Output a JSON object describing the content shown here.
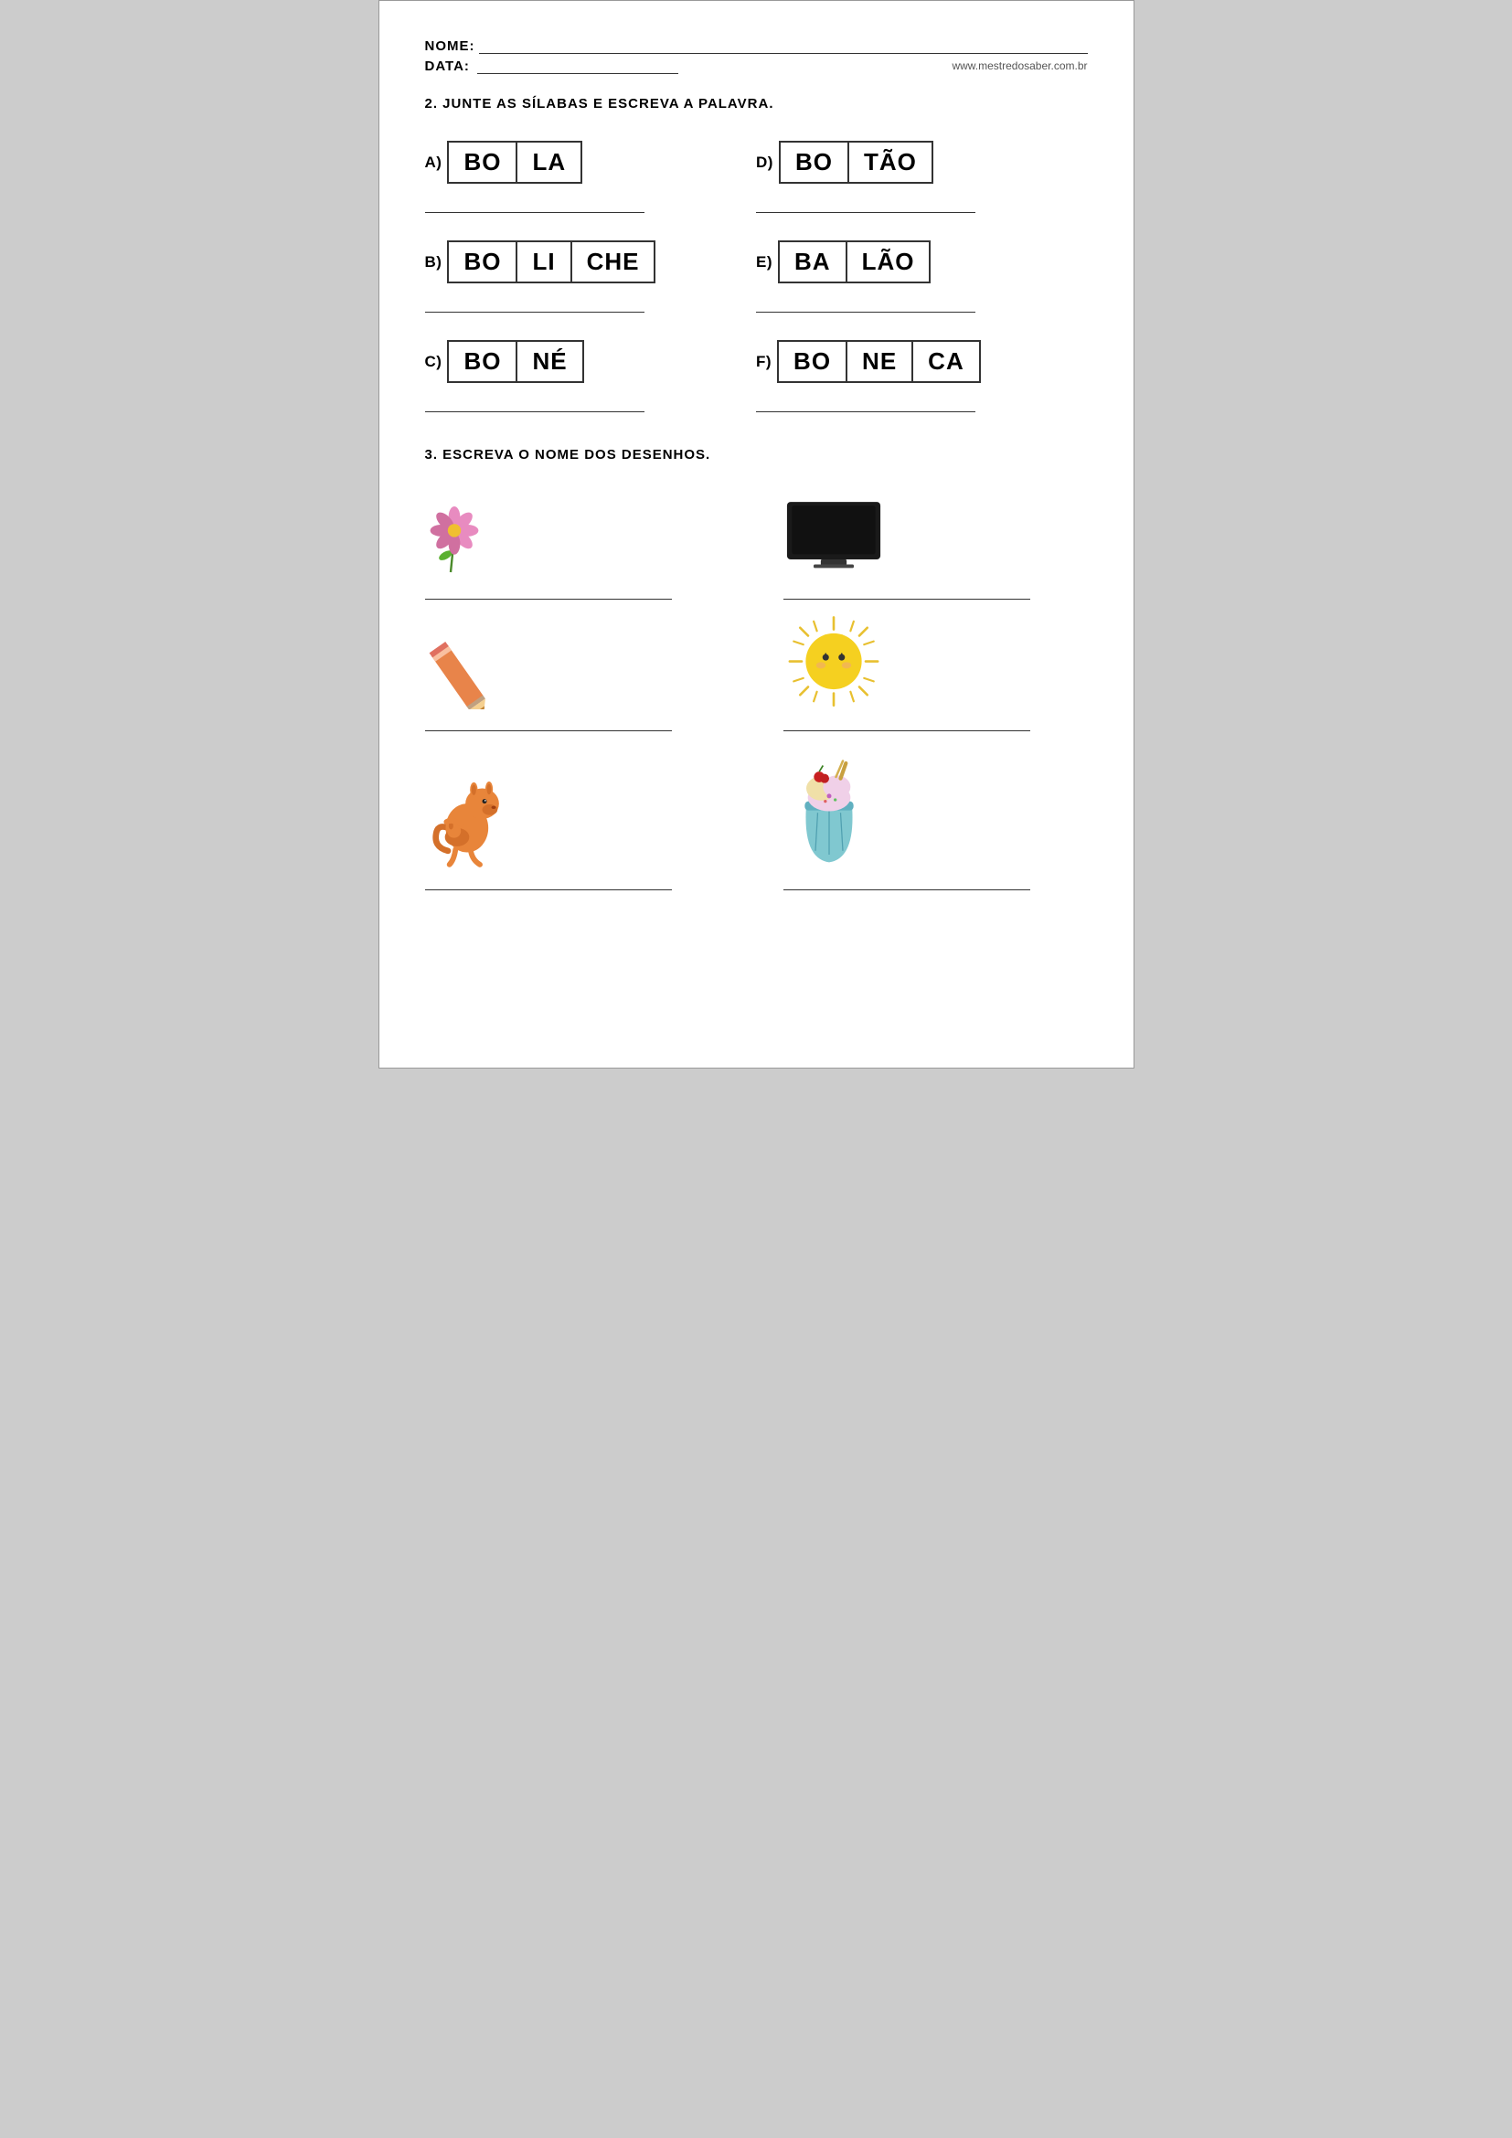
{
  "header": {
    "nome_label": "NOME:",
    "data_label": "DATA:",
    "website": "www.mestredosaber.com.br"
  },
  "section2": {
    "title": "2. JUNTE AS SÍLABAS E ESCREVA A PALAVRA.",
    "items": [
      {
        "id": "A",
        "syllables": [
          "BO",
          "LA"
        ]
      },
      {
        "id": "D",
        "syllables": [
          "BO",
          "TÃO"
        ]
      },
      {
        "id": "B",
        "syllables": [
          "BO",
          "LI",
          "CHE"
        ]
      },
      {
        "id": "E",
        "syllables": [
          "BA",
          "LÃO"
        ]
      },
      {
        "id": "C",
        "syllables": [
          "BO",
          "NÉ"
        ]
      },
      {
        "id": "F",
        "syllables": [
          "BO",
          "NE",
          "CA"
        ]
      }
    ]
  },
  "section3": {
    "title": "3. ESCREVA O NOME DOS DESENHOS.",
    "drawings": [
      {
        "id": "flower",
        "label": "flor",
        "side": "left"
      },
      {
        "id": "tv",
        "label": "televisão",
        "side": "right"
      },
      {
        "id": "pencil",
        "label": "lápis",
        "side": "left"
      },
      {
        "id": "sun",
        "label": "sol",
        "side": "right"
      },
      {
        "id": "kangaroo",
        "label": "canguru",
        "side": "left"
      },
      {
        "id": "icecream",
        "label": "sorvete",
        "side": "right"
      }
    ]
  }
}
